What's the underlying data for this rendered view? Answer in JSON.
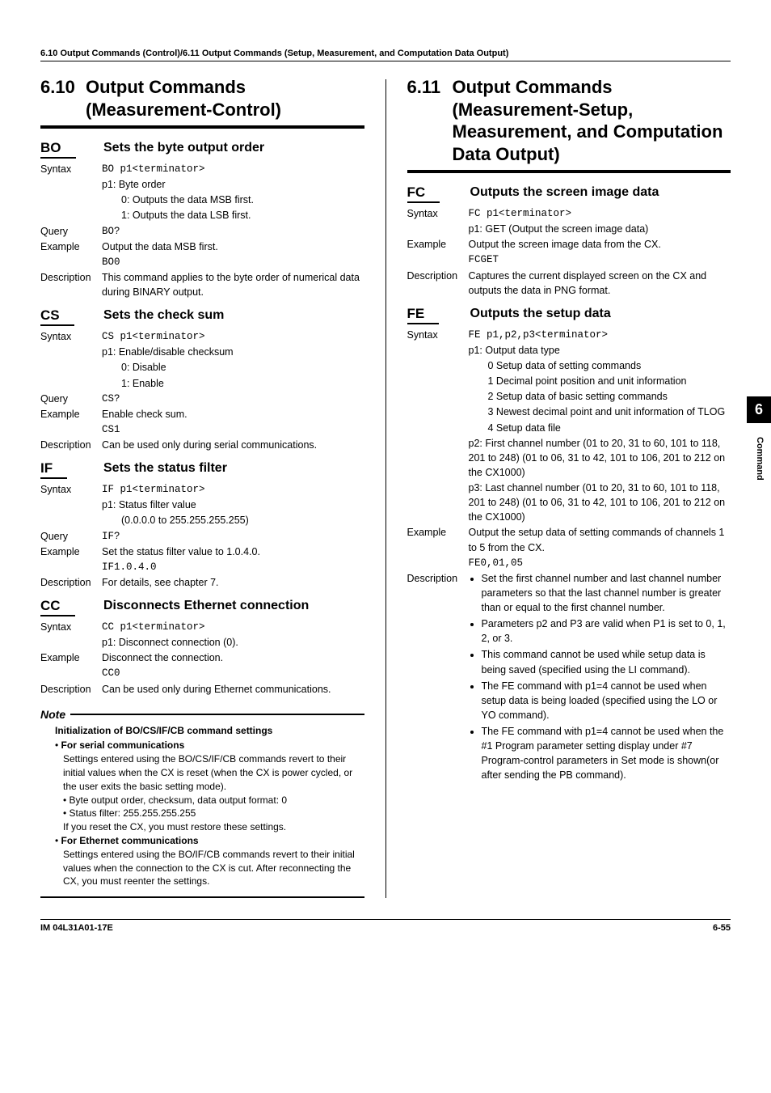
{
  "running_head": "6.10 Output Commands (Control)/6.11 Output Commands (Setup, Measurement, and Computation Data Output)",
  "side_tab_index": "6",
  "side_tab_label": "Command",
  "footer_left": "IM 04L31A01-17E",
  "footer_right": "6-55",
  "left": {
    "section_num": "6.10",
    "section_title": "Output Commands (Measurement-Control)",
    "commands": {
      "bo": {
        "code": "BO",
        "title": "Sets the byte output order",
        "syntax_code": "BO p1<terminator>",
        "syntax_p1": "p1:  Byte order",
        "syntax_lines": [
          "0: Outputs the data MSB first.",
          "1: Outputs the data LSB first."
        ],
        "query": "BO?",
        "example_text": "Output the data MSB first.",
        "example_code": "BO0",
        "description": "This command applies to the byte order of numerical data during BINARY output."
      },
      "cs": {
        "code": "CS",
        "title": "Sets the check sum",
        "syntax_code": "CS p1<terminator>",
        "syntax_p1": "p1:  Enable/disable checksum",
        "syntax_lines": [
          "0: Disable",
          "1: Enable"
        ],
        "query": "CS?",
        "example_text": "Enable check sum.",
        "example_code": "CS1",
        "description": "Can be used only during serial communications."
      },
      "if": {
        "code": "IF",
        "title": "Sets the status filter",
        "syntax_code": "IF p1<terminator>",
        "syntax_p1": "p1:  Status filter value",
        "syntax_lines": [
          "(0.0.0.0 to 255.255.255.255)"
        ],
        "query": "IF?",
        "example_text": "Set the status filter value to 1.0.4.0.",
        "example_code": "IF1.0.4.0",
        "description": "For details, see chapter 7."
      },
      "cc": {
        "code": "CC",
        "title": "Disconnects Ethernet connection",
        "syntax_code": "CC p1<terminator>",
        "syntax_p1": "p1:  Disconnect connection (0).",
        "example_text": "Disconnect the connection.",
        "example_code": "CC0",
        "description": "Can be used only during Ethernet communications."
      }
    },
    "note": {
      "label": "Note",
      "title": "Initialization of BO/CS/IF/CB command settings",
      "serial_head": "For serial communications",
      "serial_body": "Settings entered using the BO/CS/IF/CB commands revert to their initial values when the CX is reset (when the CX is power cycled, or the user exits the basic setting mode).",
      "serial_b1": "Byte output order, checksum, data output format: 0",
      "serial_b2": "Status filter: 255.255.255.255",
      "serial_tail": "If you reset the CX, you must restore these settings.",
      "eth_head": "For Ethernet communications",
      "eth_body": "Settings entered using the BO/IF/CB commands revert to their initial values when the connection to the CX is cut. After reconnecting the CX, you must reenter the settings."
    }
  },
  "right": {
    "section_num": "6.11",
    "section_title": "Output Commands (Measurement-Setup, Measurement, and Computation Data Output)",
    "fc": {
      "code": "FC",
      "title": "Outputs the screen image data",
      "syntax_code": "FC p1<terminator>",
      "syntax_p1": "p1:  GET (Output the screen image data)",
      "example_text": "Output the screen image data from the CX.",
      "example_code": "FCGET",
      "description": "Captures the current displayed screen on the CX and outputs the data in PNG format."
    },
    "fe": {
      "code": "FE",
      "title": "Outputs the setup data",
      "syntax_code": "FE p1,p2,p3<terminator>",
      "p1_label": "p1:  Output data type",
      "p1_opts": [
        "0   Setup data of setting commands",
        "1   Decimal point position and unit information",
        "2   Setup data of basic setting commands",
        "3   Newest decimal point and unit information of TLOG",
        "4   Setup data file"
      ],
      "p2": "p2:  First channel number (01 to 20, 31 to 60, 101 to 118, 201 to 248) (01 to 06, 31 to 42, 101 to 106, 201 to 212 on the CX1000)",
      "p3": "p3:  Last channel number (01 to 20, 31 to 60, 101 to 118, 201 to 248) (01 to 06, 31 to 42, 101 to 106, 201 to 212 on the CX1000)",
      "example_text": "Output the setup data of setting commands of channels 1 to 5 from the CX.",
      "example_code": "FE0,01,05",
      "desc_items": [
        "Set the first channel number and last channel number parameters so that the last channel number is greater than or equal to the first channel number.",
        "Parameters p2 and P3 are valid when P1 is set to 0, 1, 2, or 3.",
        "This command cannot be used while setup data is being saved (specified using the LI command).",
        "The FE command with p1=4 cannot be used when setup data is being loaded (specified using the LO or YO command).",
        "The FE command with p1=4 cannot be used when the #1 Program parameter setting display under #7 Program-control parameters in Set mode is shown(or after sending the PB command)."
      ]
    }
  },
  "labels": {
    "syntax": "Syntax",
    "query": "Query",
    "example": "Example",
    "description": "Description"
  }
}
